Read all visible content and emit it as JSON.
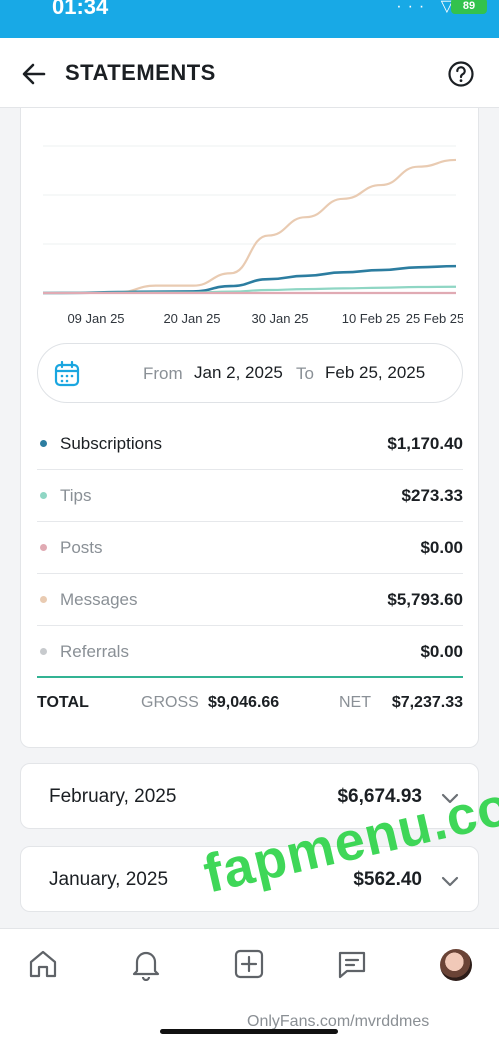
{
  "status_bar": {
    "time": "01:34",
    "icons": "···  ▽",
    "battery": "89"
  },
  "header": {
    "title": "STATEMENTS"
  },
  "chart_data": {
    "type": "line",
    "x_ticks": [
      "09 Jan 25",
      "20 Jan 25",
      "30 Jan 25",
      "10 Feb 25",
      "25 Feb 25"
    ],
    "x": [
      "Jan 2",
      "Jan 9",
      "Jan 20",
      "Jan 25",
      "Jan 30",
      "Feb 3",
      "Feb 7",
      "Feb 10",
      "Feb 14",
      "Feb 18",
      "Feb 22",
      "Feb 25"
    ],
    "series": [
      {
        "color": "#e9cbb2",
        "values": [
          0,
          5,
          35,
          320,
          320,
          860,
          2500,
          3300,
          4100,
          4700,
          5500,
          5793.6
        ]
      },
      {
        "color": "#2c7da0",
        "values": [
          0,
          5,
          40,
          60,
          70,
          300,
          600,
          750,
          900,
          1000,
          1120,
          1170.4
        ]
      },
      {
        "color": "#8fd6c4",
        "values": [
          0,
          2,
          10,
          15,
          20,
          60,
          130,
          170,
          200,
          230,
          260,
          273.33
        ]
      },
      {
        "color": "#e0aab3",
        "values": [
          0,
          0,
          0,
          0,
          0,
          0,
          0,
          0,
          0,
          0,
          0,
          0
        ]
      }
    ],
    "ylim": [
      0,
      6400
    ]
  },
  "date_range": {
    "from_label": "From",
    "from_value": "Jan 2, 2025",
    "to_label": "To",
    "to_value": "Feb 25, 2025"
  },
  "breakdown": [
    {
      "label": "Subscriptions",
      "amount": "$1,170.40",
      "color": "#2c7da0"
    },
    {
      "label": "Tips",
      "amount": "$273.33",
      "color": "#8fd6c4"
    },
    {
      "label": "Posts",
      "amount": "$0.00",
      "color": "#e0aab3"
    },
    {
      "label": "Messages",
      "amount": "$5,793.60",
      "color": "#e9cbb2"
    },
    {
      "label": "Referrals",
      "amount": "$0.00",
      "color": "#c7cacd"
    }
  ],
  "total": {
    "label": "TOTAL",
    "gross_label": "GROSS",
    "gross_value": "$9,046.66",
    "net_label": "NET",
    "net_value": "$7,237.33"
  },
  "months": [
    {
      "name": "February, 2025",
      "amount": "$6,674.93"
    },
    {
      "name": "January, 2025",
      "amount": "$562.40"
    }
  ],
  "watermark": "fapmenu.com",
  "footer_text": "OnlyFans.com/mvrddmes",
  "nav": [
    "home-icon",
    "bell-icon",
    "add-post-icon",
    "messages-icon",
    "avatar"
  ]
}
